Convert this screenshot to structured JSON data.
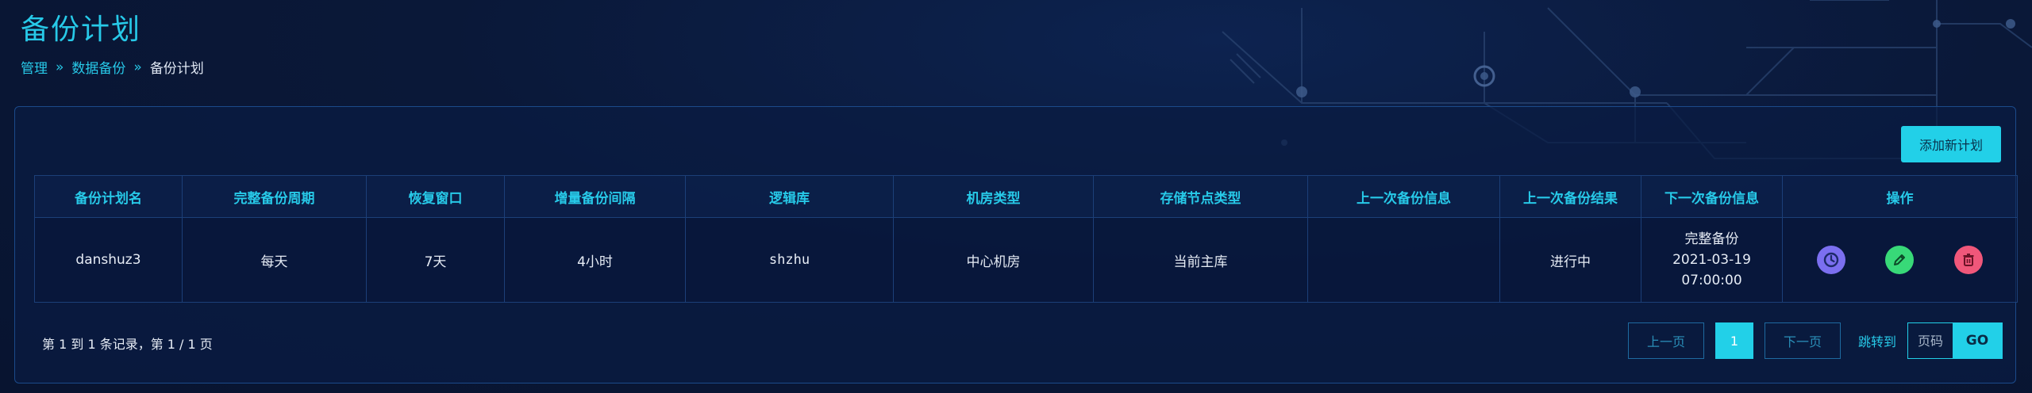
{
  "page": {
    "title": "备份计划"
  },
  "breadcrumb": {
    "items": [
      "管理",
      "数据备份"
    ],
    "current": "备份计划",
    "separator": "»"
  },
  "toolbar": {
    "add_label": "添加新计划"
  },
  "table": {
    "columns": [
      "备份计划名",
      "完整备份周期",
      "恢复窗口",
      "增量备份间隔",
      "逻辑库",
      "机房类型",
      "存储节点类型",
      "上一次备份信息",
      "上一次备份结果",
      "下一次备份信息",
      "操作"
    ],
    "rows": [
      {
        "name": "danshuz3",
        "full_cycle": "每天",
        "recovery_window": "7天",
        "incr_interval": "4小时",
        "logic_db": "shzhu",
        "room_type": "中心机房",
        "storage_type": "当前主库",
        "last_info": "",
        "last_result": "进行中",
        "next_info": [
          "完整备份",
          "2021-03-19",
          "07:00:00"
        ]
      }
    ]
  },
  "icons": {
    "history": "clock-icon",
    "edit": "pencil-icon",
    "delete": "trash-icon"
  },
  "colors": {
    "accent": "#22d0e8",
    "history": "#7b6ff0",
    "edit": "#38d978",
    "delete": "#f0577a"
  },
  "pagination": {
    "summary": "第 1 到 1 条记录，第 1 / 1 页",
    "prev_label": "上一页",
    "current_page": "1",
    "next_label": "下一页",
    "jump_label": "跳转到",
    "page_placeholder": "页码",
    "go_label": "GO"
  }
}
